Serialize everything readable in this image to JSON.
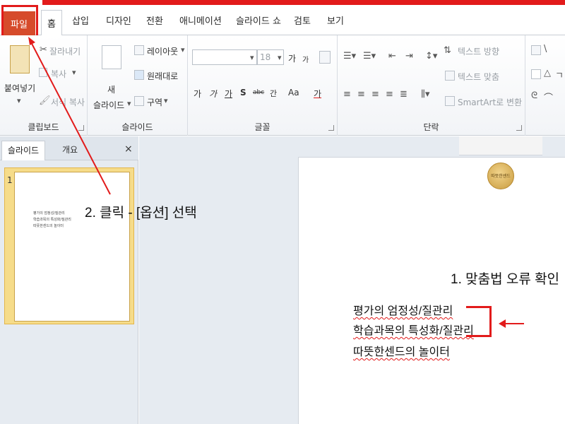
{
  "ribbon_tabs": {
    "file": "파일",
    "home": "홈",
    "insert": "삽입",
    "design": "디자인",
    "transitions": "전환",
    "animations": "애니메이션",
    "slideshow": "슬라이드 쇼",
    "review": "검토",
    "view": "보기"
  },
  "clipboard": {
    "paste": "붙여넣기",
    "cut": "잘라내기",
    "copy": "복사",
    "format_painter": "서식 복사",
    "label": "클립보드"
  },
  "slides_group": {
    "new_slide_line1": "새",
    "new_slide_line2": "슬라이드",
    "layout": "레이아웃",
    "reset": "원래대로",
    "section": "구역",
    "label": "슬라이드"
  },
  "font_group": {
    "font_size": "18",
    "grow": "가",
    "shrink": "가",
    "clear": "가",
    "bold": "가",
    "italic": "가",
    "underline": "가",
    "shadow": "S",
    "strike": "abc",
    "spacing": "간",
    "case": "Aa",
    "color": "가",
    "label": "글꼴"
  },
  "paragraph_group": {
    "text_direction": "텍스트 방향",
    "align_text": "텍스트 맞춤",
    "smartart": "SmartArt로 변환",
    "label": "단락"
  },
  "left_panel": {
    "tab_slides": "슬라이드",
    "tab_outline": "개요",
    "close": "×",
    "slide_number": "1",
    "thumb_lines": [
      "평가의 엄정성/질관리",
      "학습과목의 특성화/질관리",
      "따뜻한센드의 놀이터"
    ]
  },
  "slide": {
    "logo_text": "따뜻한센드",
    "lines": [
      "평가의 엄정성/질관리",
      "학습과목의 특성화/질관리",
      "따뜻한센드의 놀이터"
    ]
  },
  "annotations": {
    "spell_check": "1. 맞춤법 오류 확인",
    "click_options": "2. 클릭 - [옵션] 선택"
  },
  "colors": {
    "accent_red": "#e21b1b",
    "file_tab": "#d64b2b"
  }
}
